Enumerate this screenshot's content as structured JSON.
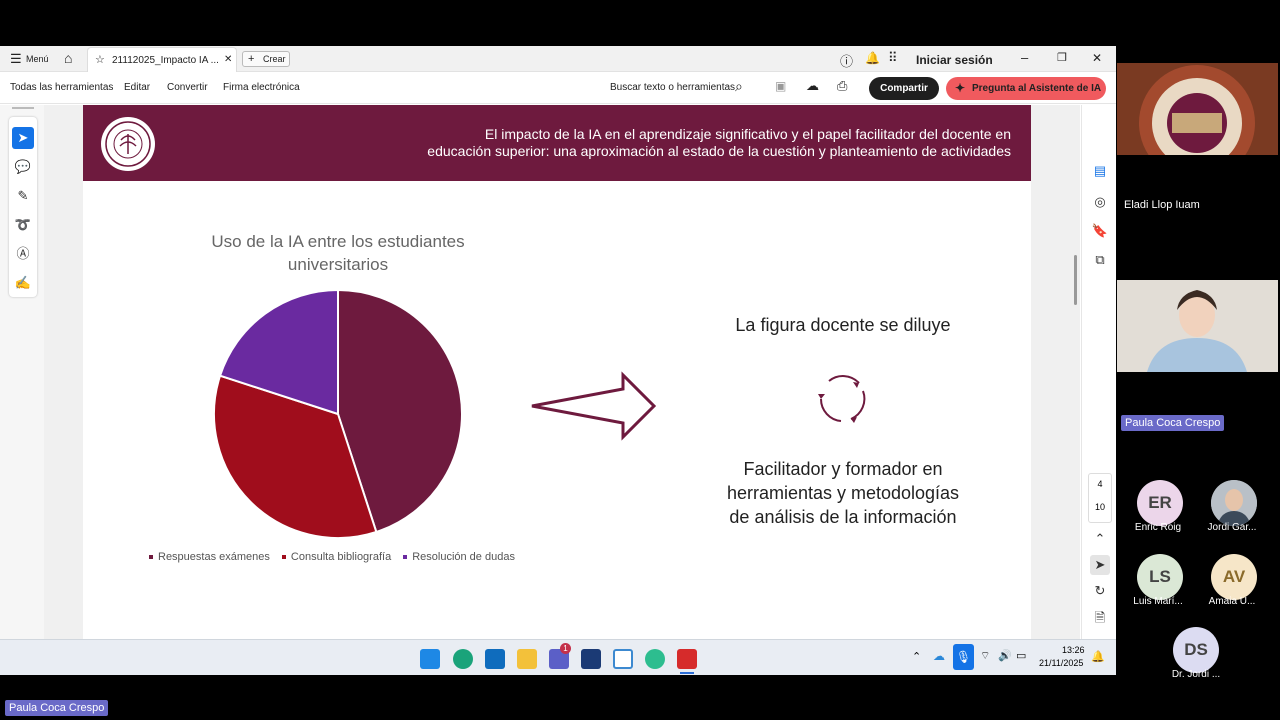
{
  "window": {
    "menu_label": "Menú",
    "tab_title": "21112025_Impacto IA ...",
    "new_tab_label": "Crear",
    "sign_in_label": "Iniciar sesión"
  },
  "toolbar": {
    "items": [
      "Todas las herramientas",
      "Editar",
      "Convertir",
      "Firma electrónica"
    ],
    "search_label": "Buscar texto o herramientas",
    "share_label": "Compartir",
    "ai_label": "Pregunta al Asistente de IA"
  },
  "slide": {
    "banner_text_line1": "El impacto de la IA en el aprendizaje significativo y el papel facilitador del docente en",
    "banner_text_line2": "educación superior: una aproximación al estado de la cuestión y planteamiento de actividades",
    "right_heading": "La figura docente se diluye",
    "right_body_line1": "Facilitador y formador en",
    "right_body_line2": "herramientas y metodologías",
    "right_body_line3": "de análisis de la información",
    "colors": {
      "banner": "#6e1a3e",
      "arrow": "#6e1a3e"
    }
  },
  "chart_data": {
    "type": "pie",
    "title_line1": "Uso de la IA entre los estudiantes",
    "title_line2": "universitarios",
    "series": [
      {
        "name": "Respuestas exámenes",
        "value": 45,
        "color": "#6e1a3e"
      },
      {
        "name": "Consulta bibliografía",
        "value": 35,
        "color": "#a00d1c"
      },
      {
        "name": "Resolución de dudas",
        "value": 20,
        "color": "#6a2aa0"
      }
    ],
    "legend_position": "bottom"
  },
  "page_nav": {
    "current": "4",
    "total": "10"
  },
  "taskbar": {
    "time": "13:26",
    "date": "21/11/2025",
    "teams_badge": "1"
  },
  "meeting": {
    "tile1_name": "Eladi  Llop Iuam",
    "tile2_name": "Paula Coca Crespo",
    "bottom_name": "Paula Coca Crespo",
    "participants": [
      {
        "initials": "ER",
        "name": "Enric Roig",
        "color": "#ecd6ea"
      },
      {
        "initials": "",
        "name": "Jordi Gar...",
        "color": "#9aa4ad"
      },
      {
        "initials": "LS",
        "name": "Luis Marí...",
        "color": "#dbe8d6"
      },
      {
        "initials": "AV",
        "name": "Amaia U...",
        "color": "#f6e6c8"
      },
      {
        "initials": "DS",
        "name": "Dr. Jordi ...",
        "color": "#dcdcf2"
      }
    ]
  }
}
